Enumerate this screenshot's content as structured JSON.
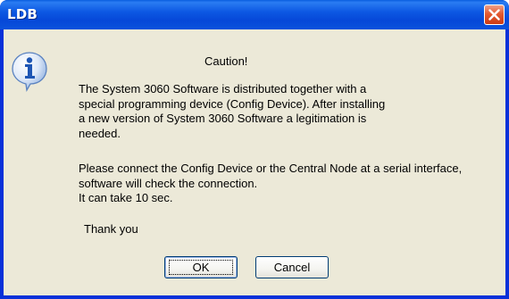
{
  "window": {
    "title": "LDB"
  },
  "dialog": {
    "caption": "Caution!",
    "paragraph1": "The System 3060 Software is distributed together with a\nspecial programming device (Config Device). After installing\na new version of System 3060 Software a legitimation is\nneeded.",
    "paragraph2": "Please connect the Config Device or the Central Node at a serial interface,\nsoftware will check the connection.\nIt can take 10 sec.",
    "thanks": "Thank you",
    "icon": "info-icon"
  },
  "buttons": {
    "ok_label": "OK",
    "cancel_label": "Cancel"
  },
  "colors": {
    "titlebar": "#0648d8",
    "client_background": "#ece9d8",
    "close_button": "#e45a30",
    "button_border": "#003c74"
  }
}
